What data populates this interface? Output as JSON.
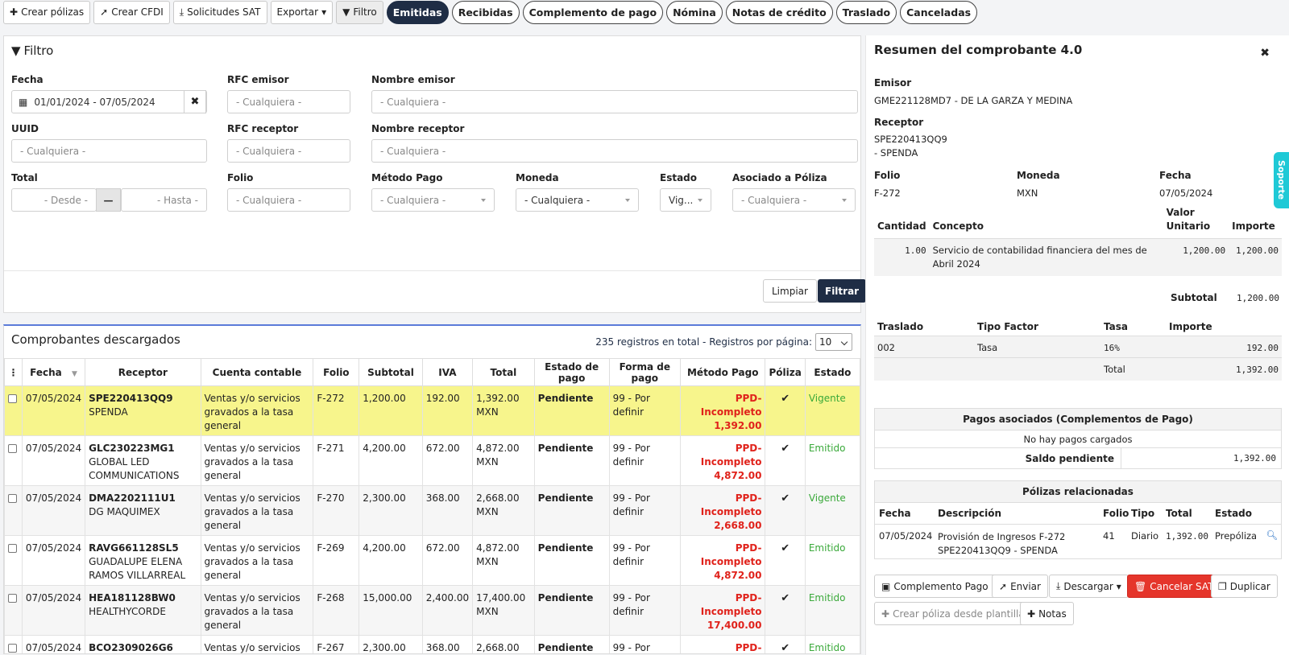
{
  "toolbar": {
    "crear_polizas": "Crear pólizas",
    "crear_cfdi": "Crear CFDI",
    "solicitudes_sat": "Solicitudes SAT",
    "exportar": "Exportar",
    "filtro": "Filtro"
  },
  "tabs": [
    "Emitidas",
    "Recibidas",
    "Complemento de pago",
    "Nómina",
    "Notas de crédito",
    "Traslado",
    "Canceladas"
  ],
  "filter": {
    "title": "Filtro",
    "fecha_label": "Fecha",
    "fecha_value": "01/01/2024 - 07/05/2024",
    "rfc_emisor_label": "RFC emisor",
    "nombre_emisor_label": "Nombre emisor",
    "uuid_label": "UUID",
    "rfc_receptor_label": "RFC receptor",
    "nombre_receptor_label": "Nombre receptor",
    "total_label": "Total",
    "folio_label": "Folio",
    "metodo_pago_label": "Método Pago",
    "moneda_label": "Moneda",
    "estado_label": "Estado",
    "poliza_label": "Asociado a Póliza",
    "any": "- Cualquiera -",
    "desde": "- Desde -",
    "hasta": "- Hasta -",
    "estado_value": "Vig...",
    "limpiar": "Limpiar",
    "filtrar": "Filtrar"
  },
  "list": {
    "title": "Comprobantes descargados",
    "info": "235 registros en total - Registros por página:",
    "per_page": "10",
    "columns": [
      "Fecha",
      "Receptor",
      "Cuenta contable",
      "Folio",
      "Subtotal",
      "IVA",
      "Total",
      "Estado de pago",
      "Forma de pago",
      "Método Pago",
      "Póliza",
      "Estado"
    ],
    "rows": [
      {
        "fecha": "07/05/2024",
        "rfc": "SPE220413QQ9",
        "nombre": "SPENDA",
        "cuenta": "Ventas y/o servicios gravados a la tasa general",
        "folio": "F-272",
        "subtotal": "1,200.00",
        "iva": "192.00",
        "total": "1,392.00 MXN",
        "estado_pago": "Pendiente",
        "forma_pago": "99 - Por definir",
        "metodo": "PPD- Incompleto",
        "metodo_monto": "1,392.00",
        "estado": "Vigente"
      },
      {
        "fecha": "07/05/2024",
        "rfc": "GLC230223MG1",
        "nombre": "GLOBAL LED COMMUNICATIONS",
        "cuenta": "Ventas y/o servicios gravados a la tasa general",
        "folio": "F-271",
        "subtotal": "4,200.00",
        "iva": "672.00",
        "total": "4,872.00 MXN",
        "estado_pago": "Pendiente",
        "forma_pago": "99 - Por definir",
        "metodo": "PPD- Incompleto",
        "metodo_monto": "4,872.00",
        "estado": "Emitido"
      },
      {
        "fecha": "07/05/2024",
        "rfc": "DMA2202111U1",
        "nombre": "DG MAQUIMEX",
        "cuenta": "Ventas y/o servicios gravados a la tasa general",
        "folio": "F-270",
        "subtotal": "2,300.00",
        "iva": "368.00",
        "total": "2,668.00 MXN",
        "estado_pago": "Pendiente",
        "forma_pago": "99 - Por definir",
        "metodo": "PPD- Incompleto",
        "metodo_monto": "2,668.00",
        "estado": "Vigente"
      },
      {
        "fecha": "07/05/2024",
        "rfc": "RAVG661128SL5",
        "nombre": "GUADALUPE ELENA RAMOS VILLARREAL",
        "cuenta": "Ventas y/o servicios gravados a la tasa general",
        "folio": "F-269",
        "subtotal": "4,200.00",
        "iva": "672.00",
        "total": "4,872.00 MXN",
        "estado_pago": "Pendiente",
        "forma_pago": "99 - Por definir",
        "metodo": "PPD- Incompleto",
        "metodo_monto": "4,872.00",
        "estado": "Emitido"
      },
      {
        "fecha": "07/05/2024",
        "rfc": "HEA181128BW0",
        "nombre": "HEALTHYCORDE",
        "cuenta": "Ventas y/o servicios gravados a la tasa general",
        "folio": "F-268",
        "subtotal": "15,000.00",
        "iva": "2,400.00",
        "total": "17,400.00 MXN",
        "estado_pago": "Pendiente",
        "forma_pago": "99 - Por definir",
        "metodo": "PPD- Incompleto",
        "metodo_monto": "17,400.00",
        "estado": "Emitido"
      },
      {
        "fecha": "07/05/2024",
        "rfc": "BCO2309026G6",
        "nombre": "",
        "cuenta": "Ventas y/o servicios",
        "folio": "F-267",
        "subtotal": "2,300.00",
        "iva": "368.00",
        "total": "2,668.00",
        "estado_pago": "Pendiente",
        "forma_pago": "99 - Por",
        "metodo": "PPD- Incompleto",
        "metodo_monto": "",
        "estado": "Emitido"
      }
    ]
  },
  "summary": {
    "title": "Resumen del comprobante 4.0",
    "emisor_label": "Emisor",
    "emisor_value": "GME221128MD7 - DE LA GARZA Y MEDINA",
    "receptor_label": "Receptor",
    "receptor_rfc": "SPE220413QQ9",
    "receptor_name": "- SPENDA",
    "folio_label": "Folio",
    "folio_value": "F-272",
    "moneda_label": "Moneda",
    "moneda_value": "MXN",
    "fecha_label": "Fecha",
    "fecha_value": "07/05/2024",
    "concept_cols": [
      "Cantidad",
      "Concepto",
      "Valor Unitario",
      "Importe"
    ],
    "concept": {
      "cantidad": "1.00",
      "concepto": "Servicio de contabilidad financiera del mes de Abril 2024",
      "valor": "1,200.00",
      "importe": "1,200.00"
    },
    "subtotal_label": "Subtotal",
    "subtotal_value": "1,200.00",
    "traslado_cols": [
      "Traslado",
      "Tipo Factor",
      "Tasa",
      "Importe"
    ],
    "traslado": {
      "traslado": "002",
      "tipo": "Tasa",
      "tasa": "16%",
      "importe": "192.00"
    },
    "total_label": "Total",
    "total_value": "1,392.00",
    "pagos_title": "Pagos asociados (Complementos de Pago)",
    "pagos_empty": "No hay pagos cargados",
    "saldo_label": "Saldo pendiente",
    "saldo_value": "1,392.00",
    "polizas_title": "Pólizas relacionadas",
    "polizas_cols": [
      "Fecha",
      "Descripción",
      "Folio",
      "Tipo",
      "Total",
      "Estado"
    ],
    "poliza": {
      "fecha": "07/05/2024",
      "descripcion": "Provisión de Ingresos F-272 SPE220413QQ9 - SPENDA",
      "folio": "41",
      "tipo": "Diario",
      "total": "1,392.00",
      "estado": "Prepóliza"
    },
    "actions": {
      "complemento": "Complemento Pago",
      "enviar": "Enviar",
      "descargar": "Descargar",
      "cancelar": "Cancelar SAT",
      "duplicar": "Duplicar",
      "crear_poliza": "Crear póliza desde plantilla",
      "notas": "Notas"
    },
    "soporte": "Soporte"
  }
}
